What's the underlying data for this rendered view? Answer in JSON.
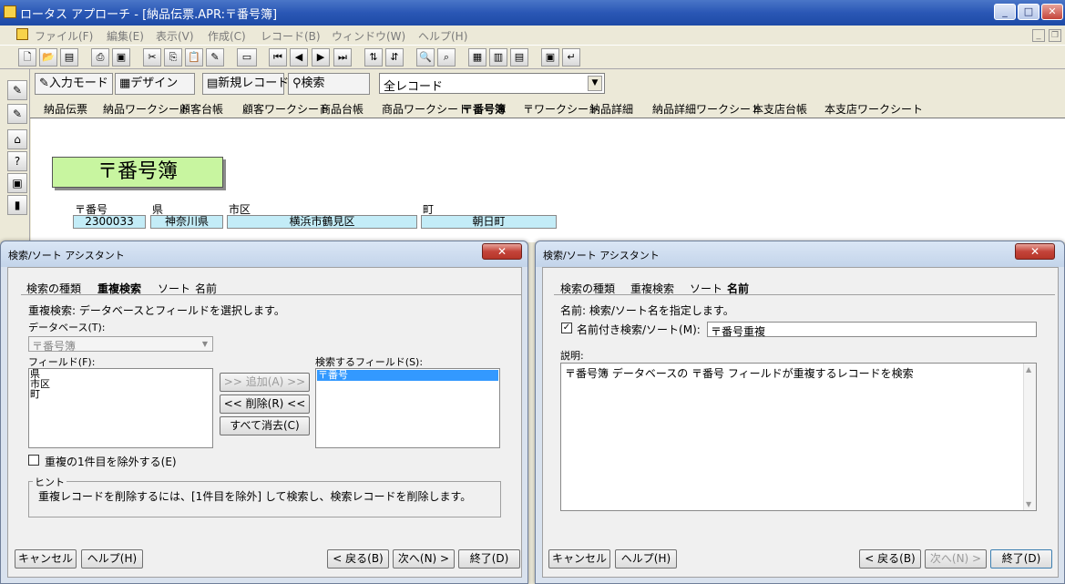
{
  "app": {
    "title": "ロータス アプローチ - [納品伝票.APR:〒番号簿]"
  },
  "menu": [
    "ファイル(F)",
    "編集(E)",
    "表示(V)",
    "作成(C)",
    "レコード(B)",
    "ウィンドウ(W)",
    "ヘルプ(H)"
  ],
  "modebar": {
    "input_mode": "入力モード",
    "design": "デザイン",
    "new_record": "新規レコード",
    "find": "検索",
    "find_select": "全レコード"
  },
  "doc_tabs": [
    "納品伝票",
    "納品ワークシート",
    "顧客台帳",
    "顧客ワークシート",
    "商品台帳",
    "商品ワークシート",
    "〒番号簿",
    "〒ワークシート",
    "納品詳細",
    "納品詳細ワークシート",
    "本支店台帳",
    "本支店ワークシート"
  ],
  "form": {
    "title": "〒番号簿",
    "fields": [
      {
        "label": "〒番号",
        "value": "2300033"
      },
      {
        "label": "県",
        "value": "神奈川県"
      },
      {
        "label": "市区",
        "value": "横浜市鶴見区"
      },
      {
        "label": "町",
        "value": "朝日町"
      }
    ]
  },
  "dialog_left": {
    "title": "検索/ソート アシスタント",
    "tabs": [
      "検索の種類",
      "重複検索",
      "ソート",
      "名前"
    ],
    "instruction": "重複検索: データベースとフィールドを選択します。",
    "database_label": "データベース(T):",
    "database_value": "〒番号簿",
    "fields_label": "フィールド(F):",
    "fields": [
      "県",
      "市区",
      "町"
    ],
    "search_fields_label": "検索するフィールド(S):",
    "search_fields": [
      "〒番号"
    ],
    "add_button": ">> 追加(A) >>",
    "remove_button": "<< 削除(R) <<",
    "clear_button": "すべて消去(C)",
    "exclude_first_label": "重複の1件目を除外する(E)",
    "hint_label": "ヒント",
    "hint_text": "重複レコードを削除するには、[1件目を除外] して検索し、検索レコードを削除します。",
    "cancel": "キャンセル",
    "help": "ヘルプ(H)",
    "back": "< 戻る(B)",
    "next": "次へ(N) >",
    "finish": "終了(D)"
  },
  "dialog_right": {
    "title": "検索/ソート アシスタント",
    "tabs": [
      "検索の種類",
      "重複検索",
      "ソート",
      "名前"
    ],
    "instruction": "名前: 検索/ソート名を指定します。",
    "named_checkbox_label": "名前付き検索/ソート(M):",
    "named_checkbox_mark": "✓",
    "name_value": "〒番号重複",
    "description_label": "説明:",
    "description": "〒番号簿 データベースの 〒番号 フィールドが重複するレコードを検索",
    "cancel": "キャンセル",
    "help": "ヘルプ(H)",
    "back": "< 戻る(B)",
    "next": "次へ(N) >",
    "finish": "終了(D)"
  }
}
